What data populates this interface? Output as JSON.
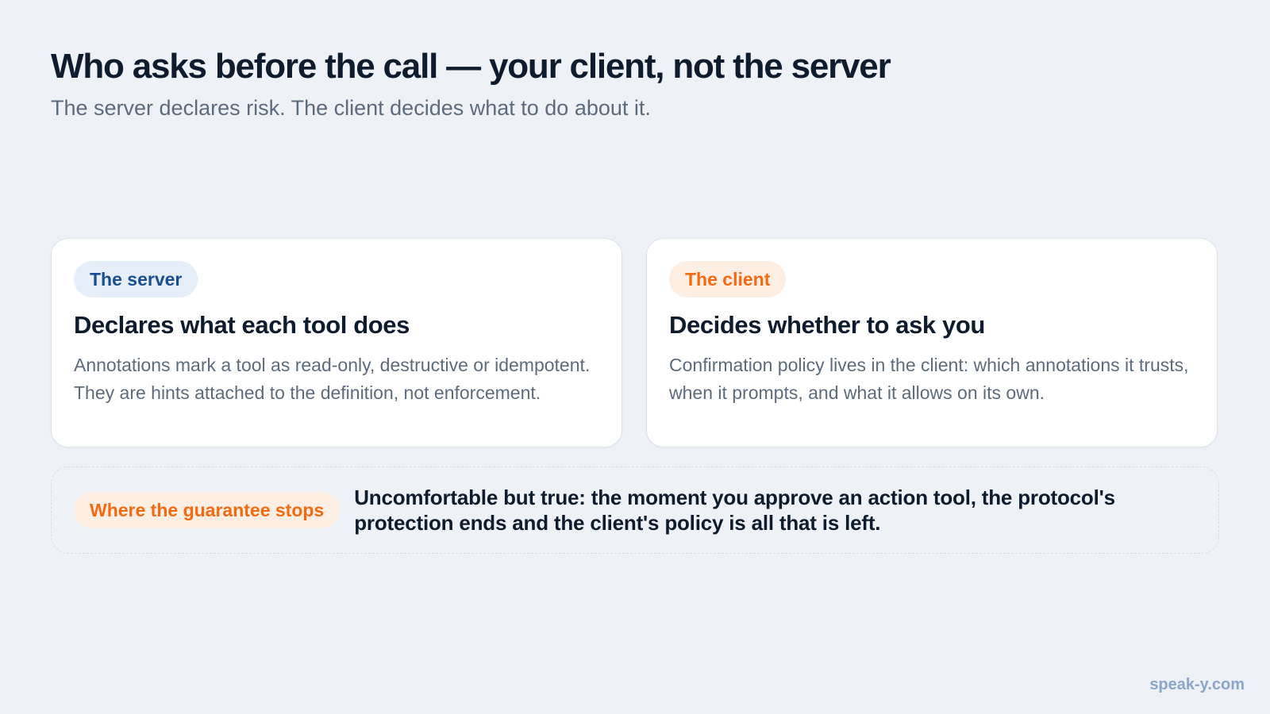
{
  "slide": {
    "title": "Who asks before the call — your client, not the server",
    "subtitle": "The server declares risk. The client decides what to do about it."
  },
  "cards": [
    {
      "tag": "The server",
      "tag_color": "#1a4f8f",
      "tag_background": "#e6eff9",
      "heading": "Declares what each tool does",
      "body": "Annotations mark a tool as read-only, destructive or idempotent. They are hints attached to the definition, not enforcement."
    },
    {
      "tag": "The client",
      "tag_color": "#f26b12",
      "tag_background": "#fdeee3",
      "heading": "Decides whether to ask you",
      "body": "Confirmation policy lives in the client: which annotations it trusts, when it prompts, and what it allows on its own."
    }
  ],
  "note": {
    "tag": "Where the guarantee stops",
    "text": "Uncomfortable but true: the moment you approve an action tool, the protocol's protection ends and the client's policy is all that is left."
  },
  "footer": {
    "brand": "speak-y.com"
  },
  "colors": {
    "background": "#eef1f6",
    "heading": "#0f1c2e",
    "body_text": "#5d6b7d",
    "brand": "#8aa6c8"
  }
}
